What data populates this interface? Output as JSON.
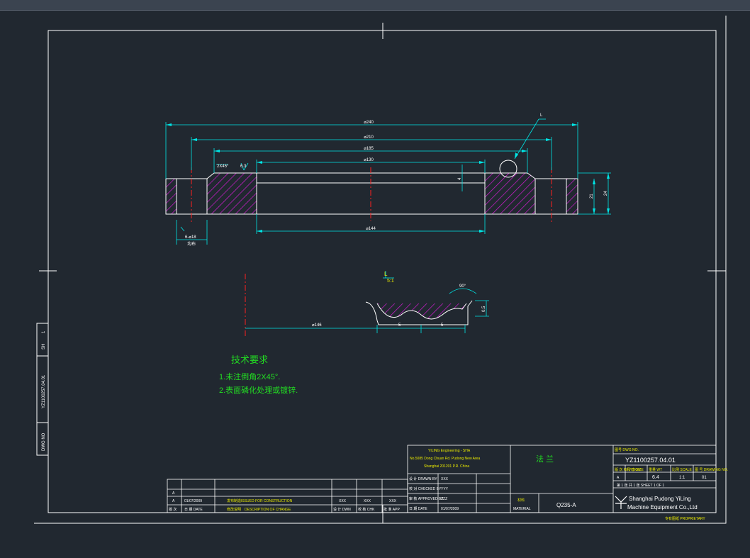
{
  "colors": {
    "background": "#212830",
    "frame": "#ffffff",
    "dimension": "#00e5e5",
    "part": "#ffffff",
    "hatch": "#d01dd0",
    "centerline": "#ff2020",
    "leader": "#00e5e5",
    "notes": "#22dd22",
    "titleblock_text": "#ffffff",
    "titleblock_text_alt": "#e8e800"
  },
  "dims": {
    "d240": "⌀240",
    "d210": "⌀210",
    "d185": "⌀185",
    "d130": "⌀130",
    "d144": "⌀144",
    "d146": "⌀146",
    "chamfer": "2X45°",
    "rough": "6.3",
    "leader_L": "L",
    "height_21": "21",
    "height_24": "24",
    "depth_4": "4",
    "holes": "6-⌀18",
    "holes_note": "均布",
    "detail_label": "L",
    "detail_scale": "5:1",
    "angle_90": "90°",
    "pitch_1": "5",
    "pitch_2": "5",
    "depth_05": "0.5"
  },
  "notes": {
    "title": "技术要求",
    "line1": "1.未注倒角2X45°.",
    "line2": "2.表面磷化处理或镀锌."
  },
  "sidebar": {
    "sheet": "SH",
    "sheet_no": "1",
    "drawing_no": "YZ1100257.04.01",
    "dwg_no_label": "DWG NO"
  },
  "revision_block": {
    "rows": [
      {
        "mark": "A",
        "date": "",
        "desc": "",
        "dwn": "",
        "chk": "",
        "apr": ""
      },
      {
        "mark": "A",
        "date": "01/07/2009",
        "desc": "发布制造ISSUED FOR CONSTRUCTION",
        "dwn": "XXX",
        "chk": "XXX",
        "apr": "XXX"
      }
    ],
    "headers": {
      "mark": "版 次",
      "rev": "REV",
      "date": "日 期 DATE",
      "desc_cn": "修改说明",
      "desc": "DESCRIPTION OF CHANGE",
      "dwn": "设 计 DWN",
      "chk": "校 核 CHK",
      "apr": "批 准 APP"
    }
  },
  "company": {
    "line1": "YILING Engineering - SHA",
    "line2": "No.5085 Dong Chuan Rd. Pudong New Area",
    "line3": "Shanghai 201201 P.R. China"
  },
  "signatures": [
    {
      "label": "设 计 DRAWN BY",
      "value": "XXX"
    },
    {
      "label": "校 对 CHECKED BY",
      "value": "YYY"
    },
    {
      "label": "审 核 APPROVED BY",
      "value": "ZZZ"
    },
    {
      "label": "日 期 DATE",
      "value": "01/07/2009"
    }
  ],
  "part": {
    "name": "法 兰",
    "material_label_cn": "材料",
    "material_label": "MATERIAL",
    "material": "Q235-A"
  },
  "titleblock": {
    "drawing_no_label": "图号 DWG NO.",
    "drawing_no": "YZ1100257.04.01",
    "headers": [
      "版 次 REVISION",
      "尺 寸 SIZE",
      "重量 WT",
      "比例 SCALE",
      "图 号 DRAWING NO."
    ],
    "values": [
      "A",
      "",
      "6.4",
      "1:1",
      "01"
    ],
    "sheet_label": "第 1 张 共 1 张 SHEET 1 OF 1",
    "company_name_1": "Shanghai Pudong YiLing",
    "company_name_2": "Machine Equipment Co.,Ltd",
    "proprietary": "专有图纸 PROPRIETARY"
  }
}
